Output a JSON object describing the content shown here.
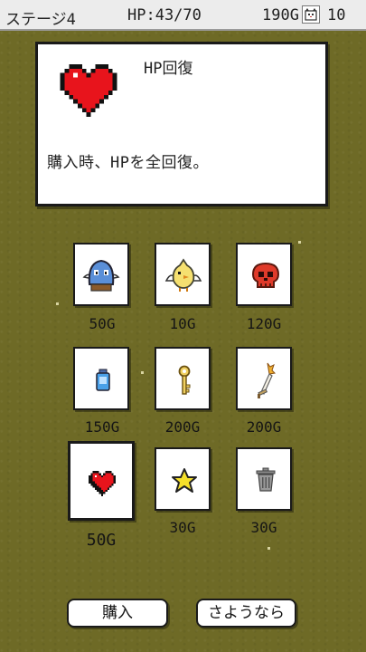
{
  "status": {
    "stage": "ステージ4",
    "hp": "HP:43/70",
    "gold": "190G",
    "lives_icon": "cat-face-icon",
    "lives": "10"
  },
  "description": {
    "title": "HP回復",
    "icon": "heart-icon",
    "text": "購入時、HPを全回復。"
  },
  "shop_items": [
    {
      "icon": "blue-blob-monster-icon",
      "price": "50G"
    },
    {
      "icon": "yellow-bird-icon",
      "price": "10G"
    },
    {
      "icon": "red-skull-icon",
      "price": "120G"
    },
    {
      "icon": "blue-potion-bottle-icon",
      "price": "150G"
    },
    {
      "icon": "gold-key-icon",
      "price": "200G"
    },
    {
      "icon": "flaming-sword-icon",
      "price": "200G"
    },
    {
      "icon": "heart-icon",
      "price": "50G",
      "selected": true
    },
    {
      "icon": "yellow-star-icon",
      "price": "30G"
    },
    {
      "icon": "trash-can-icon",
      "price": "30G"
    }
  ],
  "buttons": {
    "buy": "購入",
    "goodbye": "さようなら"
  },
  "colors": {
    "background": "#6e6a26",
    "heart": "#e8141c",
    "star": "#f5e02a"
  }
}
